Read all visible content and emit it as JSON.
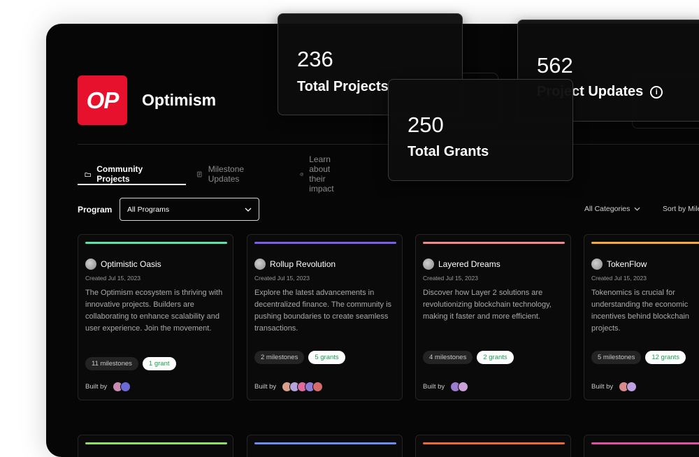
{
  "org": {
    "logo_text": "OP",
    "name": "Optimism",
    "brand_color": "#e8112d"
  },
  "tabs": [
    {
      "label": "Community Projects",
      "icon": "folder-icon"
    },
    {
      "label": "Milestone Updates",
      "icon": "document-icon"
    },
    {
      "label": "Learn about their impact",
      "icon": "target-icon"
    }
  ],
  "program": {
    "label": "Program",
    "selected": "All Programs"
  },
  "filters": {
    "categories": "All Categories",
    "sort": "Sort by Milestones"
  },
  "cards": [
    {
      "title": "Optimistic Oasis",
      "created": "Created Jul 15, 2023",
      "desc": "The Optimism ecosystem is thriving with innovative projects. Builders are collaborating to enhance scalability and user experience. Join the movement.",
      "milestones": "11 milestones",
      "grants": "1 grant",
      "built_by": "Built by",
      "accent": "#5ee0a6",
      "avatars": [
        "#c98bb0",
        "#6b6bd8"
      ]
    },
    {
      "title": "Rollup Revolution",
      "created": "Created Jul 15, 2023",
      "desc": "Explore the latest advancements in decentralized finance. The community is pushing boundaries to create seamless transactions.",
      "milestones": "2 milestones",
      "grants": "5 grants",
      "built_by": "Built by",
      "accent": "#7b5fe8",
      "avatars": [
        "#d8a08b",
        "#b3a4dd",
        "#e06a9b",
        "#8e7cd6",
        "#d66b6b"
      ]
    },
    {
      "title": "Layered Dreams",
      "created": "Created Jul 15, 2023",
      "desc": "Discover how Layer 2 solutions are revolutionizing blockchain technology, making it faster and more efficient.",
      "milestones": "4 milestones",
      "grants": "2 grants",
      "built_by": "Built by",
      "accent": "#f08a8a",
      "avatars": [
        "#9a7bd0",
        "#c9a2d8"
      ]
    },
    {
      "title": "TokenFlow",
      "created": "Created Jul 15, 2023",
      "desc": "Tokenomics is crucial for understanding the economic incentives behind blockchain projects.",
      "milestones": "5 milestones",
      "grants": "12 grants",
      "built_by": "Built by",
      "accent": "#f5a93b",
      "avatars": [
        "#d88b8b",
        "#bfa0e0"
      ]
    }
  ],
  "bottom_accents": [
    "#8ee05c",
    "#6e8cf0",
    "#ef6a2f",
    "#e04fa8"
  ],
  "stats": {
    "projects": {
      "value": "236",
      "label": "Total Projects"
    },
    "grants": {
      "value": "250",
      "label": "Total Grants"
    },
    "updates": {
      "value": "562",
      "label": "Project Updates"
    }
  }
}
